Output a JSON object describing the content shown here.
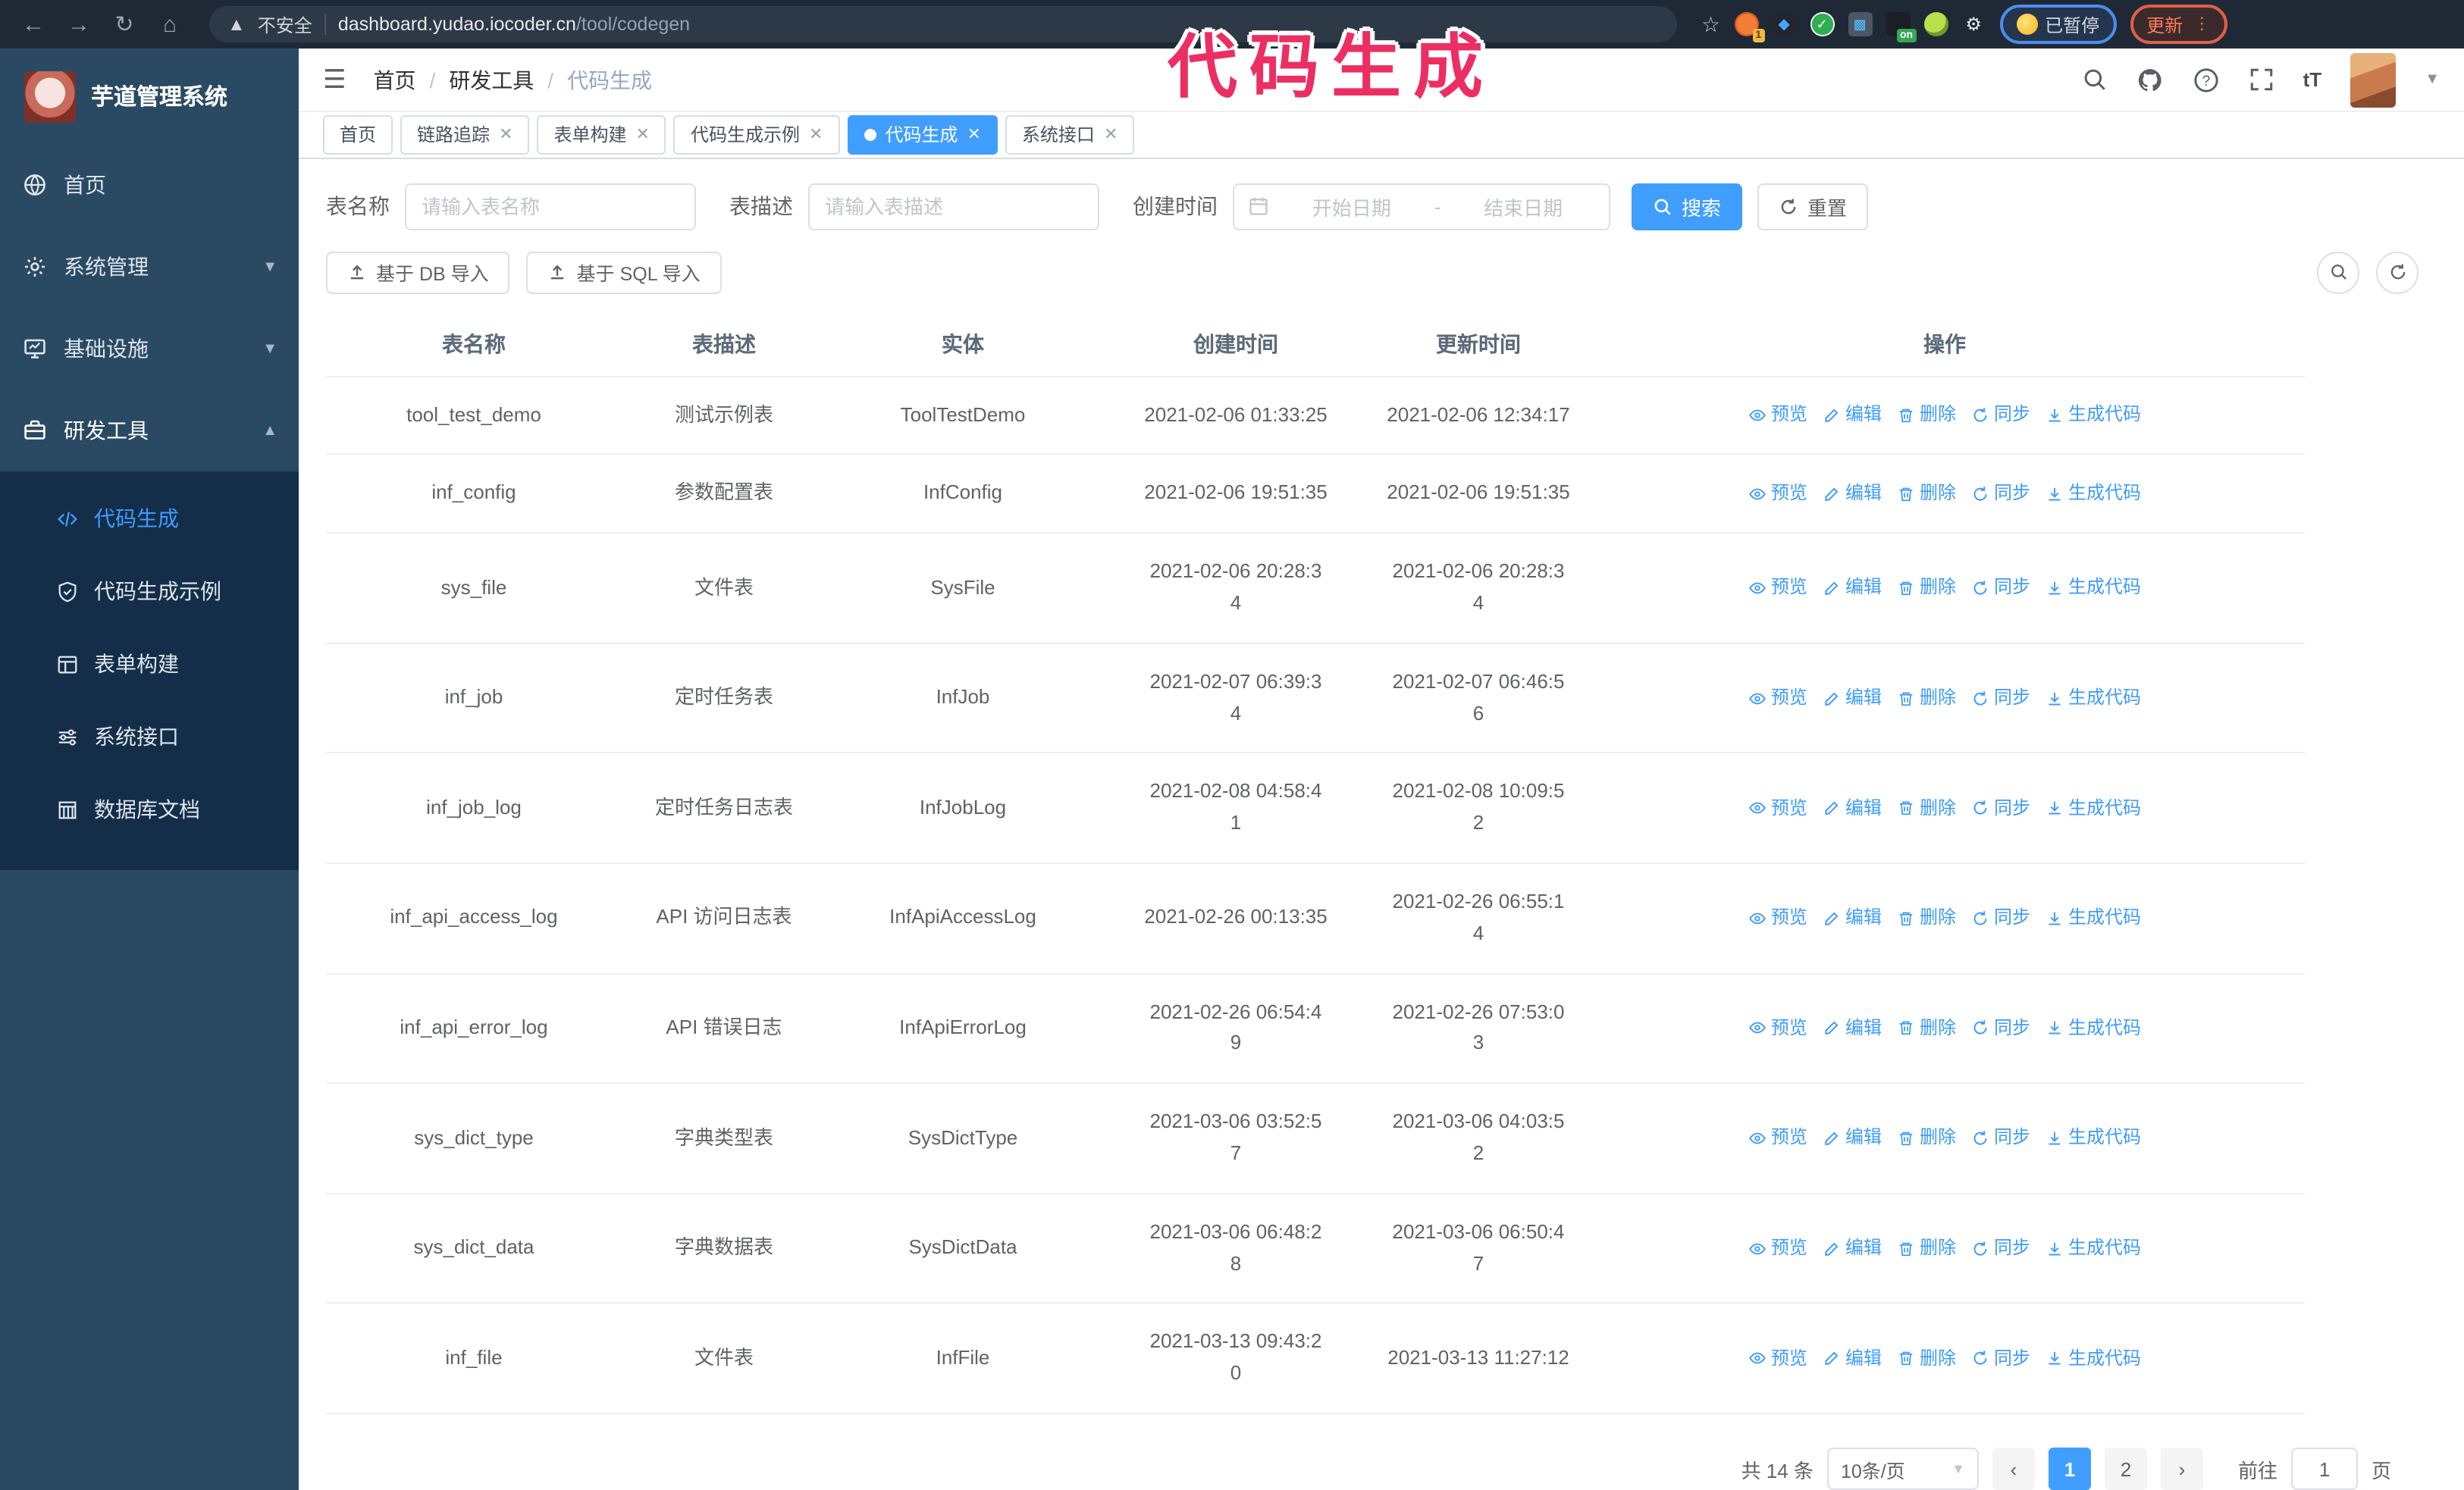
{
  "annotation": {
    "text": "代码生成",
    "color": "#ec2e63"
  },
  "browser": {
    "security_label": "不安全",
    "url_host": "dashboard.yudao.iocoder.cn",
    "url_path": "/tool/codegen",
    "extension_badge": "1",
    "on_badge": "on",
    "paused_label": "已暂停",
    "update_label": "更新"
  },
  "sidebar": {
    "title": "芋道管理系统",
    "items": [
      {
        "label": "首页"
      },
      {
        "label": "系统管理"
      },
      {
        "label": "基础设施"
      },
      {
        "label": "研发工具"
      }
    ],
    "submenu": [
      {
        "label": "代码生成",
        "active": true
      },
      {
        "label": "代码生成示例"
      },
      {
        "label": "表单构建"
      },
      {
        "label": "系统接口"
      },
      {
        "label": "数据库文档"
      }
    ]
  },
  "header": {
    "breadcrumb": [
      "首页",
      "研发工具",
      "代码生成"
    ]
  },
  "tabs": [
    {
      "label": "首页"
    },
    {
      "label": "链路追踪"
    },
    {
      "label": "表单构建"
    },
    {
      "label": "代码生成示例"
    },
    {
      "label": "代码生成",
      "active": true
    },
    {
      "label": "系统接口"
    }
  ],
  "filters": {
    "name_label": "表名称",
    "name_placeholder": "请输入表名称",
    "desc_label": "表描述",
    "desc_placeholder": "请输入表描述",
    "time_label": "创建时间",
    "start_placeholder": "开始日期",
    "separator": "-",
    "end_placeholder": "结束日期",
    "search_label": "搜索",
    "reset_label": "重置"
  },
  "toolbar": {
    "db_import": "基于 DB 导入",
    "sql_import": "基于 SQL 导入"
  },
  "table": {
    "columns": [
      "表名称",
      "表描述",
      "实体",
      "创建时间",
      "更新时间",
      "操作"
    ],
    "actions": [
      "预览",
      "编辑",
      "删除",
      "同步",
      "生成代码"
    ],
    "rows": [
      {
        "name": "tool_test_demo",
        "desc": "测试示例表",
        "entity": "ToolTestDemo",
        "created": "2021-02-06 01:33:25",
        "updated": "2021-02-06 12:34:17"
      },
      {
        "name": "inf_config",
        "desc": "参数配置表",
        "entity": "InfConfig",
        "created": "2021-02-06 19:51:35",
        "updated": "2021-02-06 19:51:35"
      },
      {
        "name": "sys_file",
        "desc": "文件表",
        "entity": "SysFile",
        "created": "2021-02-06 20:28:3\n4",
        "updated": "2021-02-06 20:28:3\n4"
      },
      {
        "name": "inf_job",
        "desc": "定时任务表",
        "entity": "InfJob",
        "created": "2021-02-07 06:39:3\n4",
        "updated": "2021-02-07 06:46:5\n6"
      },
      {
        "name": "inf_job_log",
        "desc": "定时任务日志表",
        "entity": "InfJobLog",
        "created": "2021-02-08 04:58:4\n1",
        "updated": "2021-02-08 10:09:5\n2"
      },
      {
        "name": "inf_api_access_log",
        "desc": "API 访问日志表",
        "entity": "InfApiAccessLog",
        "created": "2021-02-26 00:13:35",
        "updated": "2021-02-26 06:55:1\n4"
      },
      {
        "name": "inf_api_error_log",
        "desc": "API 错误日志",
        "entity": "InfApiErrorLog",
        "created": "2021-02-26 06:54:4\n9",
        "updated": "2021-02-26 07:53:0\n3"
      },
      {
        "name": "sys_dict_type",
        "desc": "字典类型表",
        "entity": "SysDictType",
        "created": "2021-03-06 03:52:5\n7",
        "updated": "2021-03-06 04:03:5\n2"
      },
      {
        "name": "sys_dict_data",
        "desc": "字典数据表",
        "entity": "SysDictData",
        "created": "2021-03-06 06:48:2\n8",
        "updated": "2021-03-06 06:50:4\n7"
      },
      {
        "name": "inf_file",
        "desc": "文件表",
        "entity": "InfFile",
        "created": "2021-03-13 09:43:2\n0",
        "updated": "2021-03-13 11:27:12"
      }
    ]
  },
  "pagination": {
    "total": "共 14 条",
    "page_size": "10条/页",
    "pages": [
      "1",
      "2"
    ],
    "goto_label": "前往",
    "goto_value": "1",
    "page_label": "页"
  }
}
